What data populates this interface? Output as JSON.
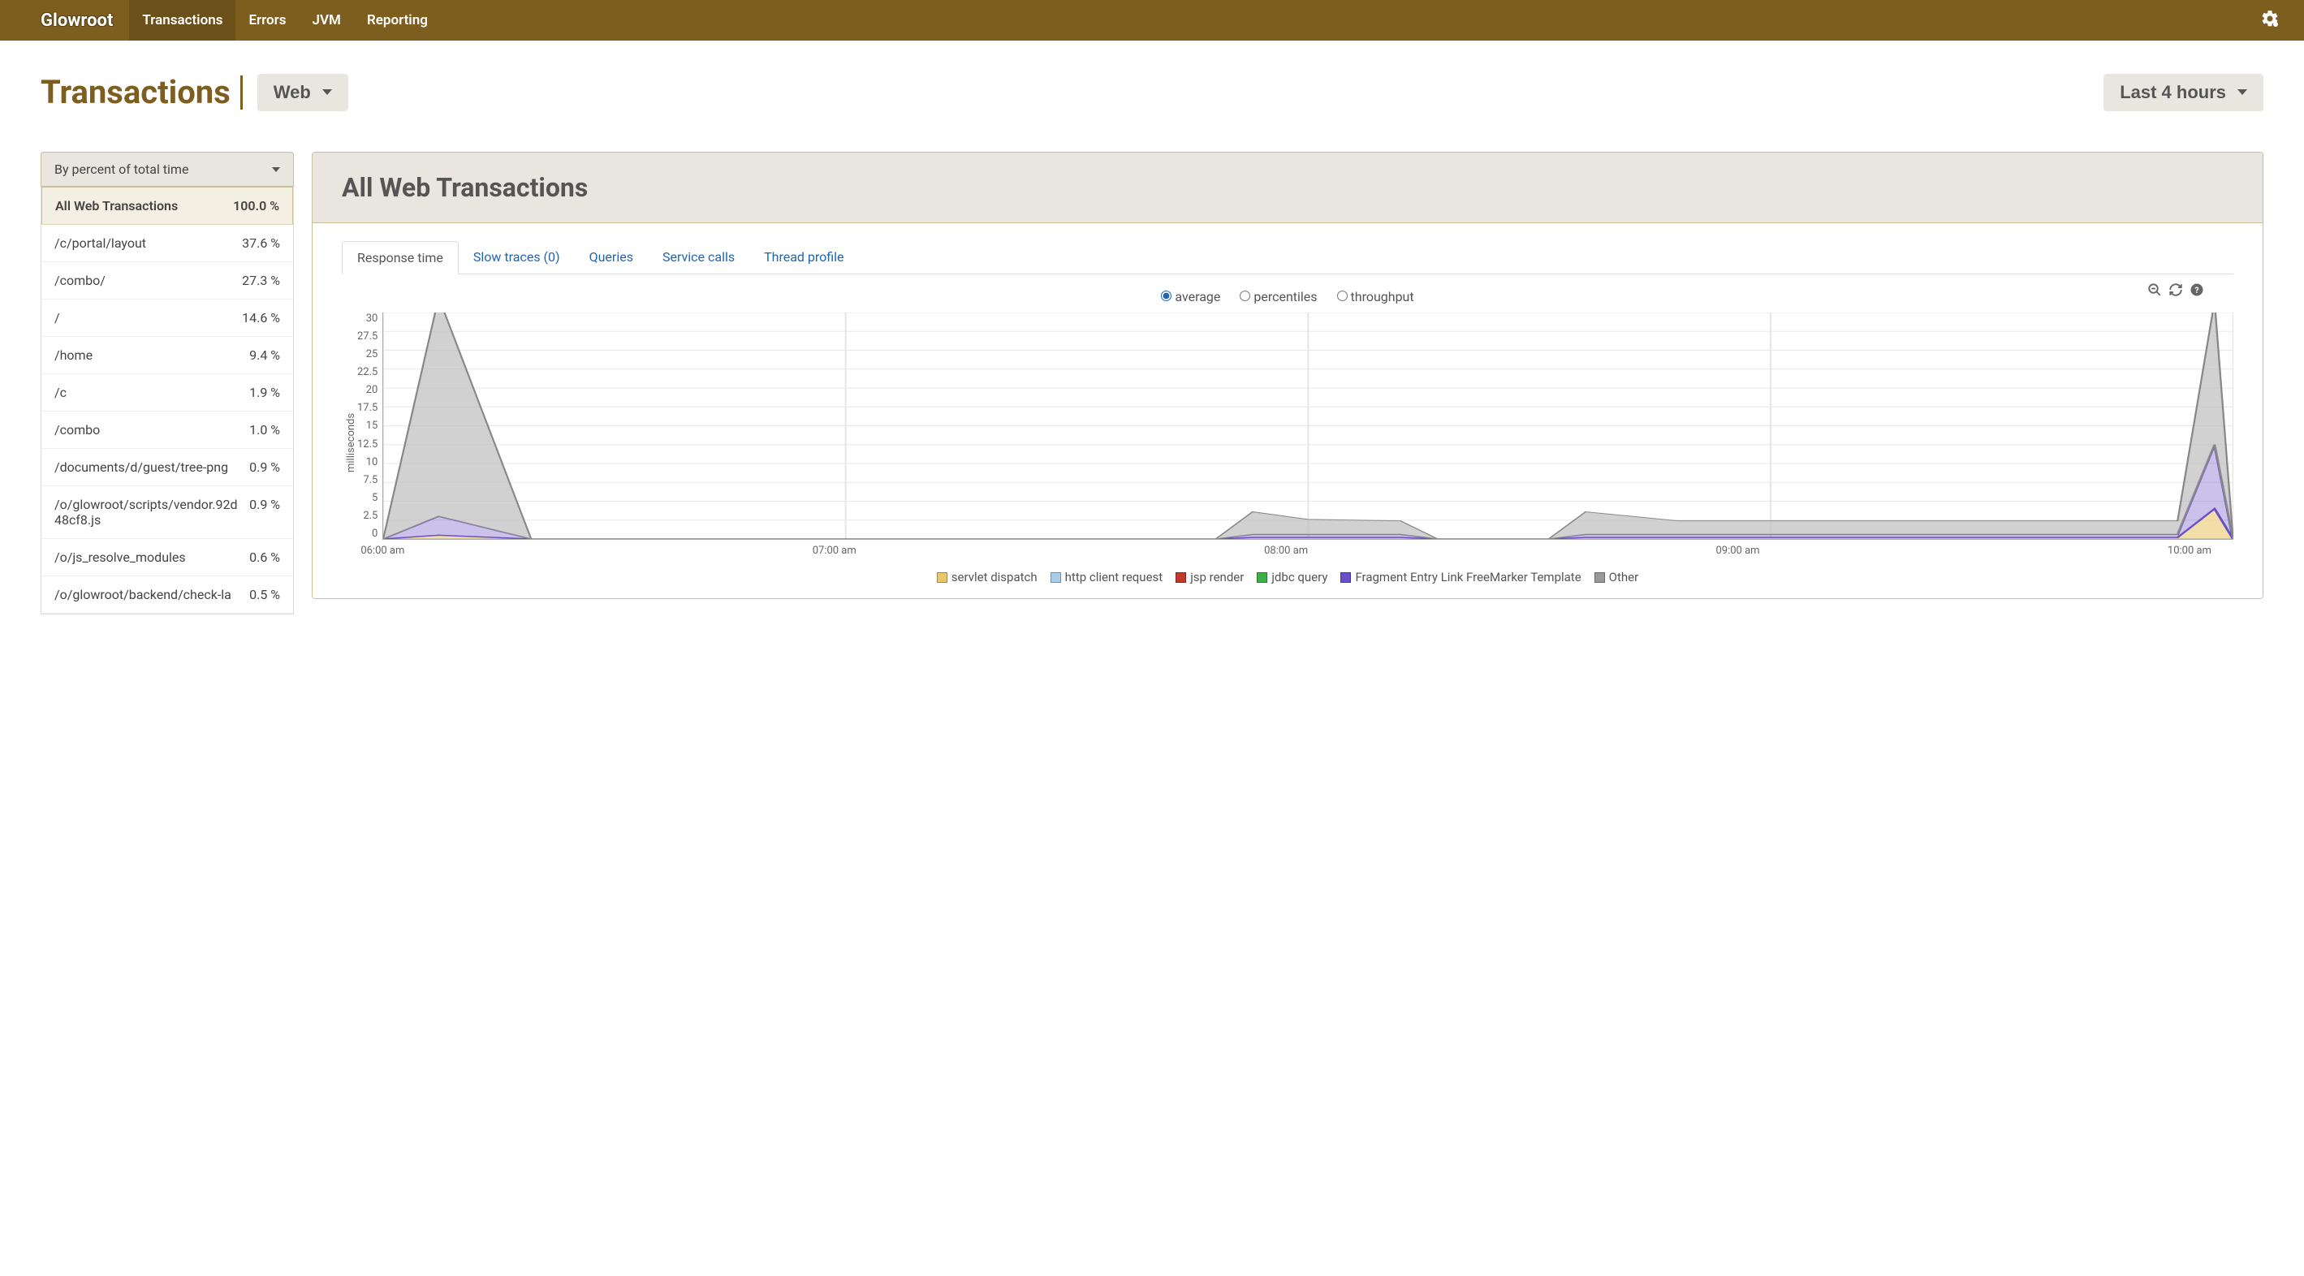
{
  "brand": "Glowroot",
  "nav": {
    "items": [
      {
        "label": "Transactions",
        "active": true
      },
      {
        "label": "Errors",
        "active": false
      },
      {
        "label": "JVM",
        "active": false
      },
      {
        "label": "Reporting",
        "active": false
      }
    ]
  },
  "page_title": "Transactions",
  "type_dropdown": "Web",
  "time_range": "Last 4 hours",
  "sort_by": "By percent of total time",
  "transactions": [
    {
      "name": "All Web Transactions",
      "pct": "100.0 %",
      "selected": true
    },
    {
      "name": "/c/portal/layout",
      "pct": "37.6 %"
    },
    {
      "name": "/combo/",
      "pct": "27.3 %"
    },
    {
      "name": "/",
      "pct": "14.6 %"
    },
    {
      "name": "/home",
      "pct": "9.4 %"
    },
    {
      "name": "/c",
      "pct": "1.9 %"
    },
    {
      "name": "/combo",
      "pct": "1.0 %"
    },
    {
      "name": "/documents/d/guest/tree-png",
      "pct": "0.9 %"
    },
    {
      "name": "/o/glowroot/scripts/vendor.92d48cf8.js",
      "pct": "0.9 %"
    },
    {
      "name": "/o/js_resolve_modules",
      "pct": "0.6 %"
    },
    {
      "name": "/o/glowroot/backend/check-la",
      "pct": "0.5 %"
    }
  ],
  "main_title": "All Web Transactions",
  "tabs": [
    {
      "label": "Response time",
      "active": true
    },
    {
      "label": "Slow traces (0)"
    },
    {
      "label": "Queries"
    },
    {
      "label": "Service calls"
    },
    {
      "label": "Thread profile"
    }
  ],
  "radios": {
    "average": "average",
    "percentiles": "percentiles",
    "throughput": "throughput"
  },
  "chart_data": {
    "type": "area",
    "title": "",
    "xlabel": "",
    "ylabel": "milliseconds",
    "ylim": [
      0,
      30
    ],
    "yticks": [
      30,
      27.5,
      25,
      22.5,
      20,
      17.5,
      15,
      12.5,
      10,
      7.5,
      5,
      2.5,
      0
    ],
    "xticks": [
      "06:00 am",
      "07:00 am",
      "08:00 am",
      "09:00 am",
      "10:00 am"
    ],
    "series": [
      {
        "name": "servlet dispatch",
        "color": "#e9c86b"
      },
      {
        "name": "http client request",
        "color": "#a9cce8"
      },
      {
        "name": "jsp render",
        "color": "#c0392b"
      },
      {
        "name": "jdbc query",
        "color": "#3fae49"
      },
      {
        "name": "Fragment Entry Link FreeMarker Template",
        "color": "#6b4fc9"
      },
      {
        "name": "Other",
        "color": "#999999"
      }
    ],
    "stacked_points": [
      {
        "x": 0.0,
        "fragment": 0,
        "other": 0,
        "servlet": 0
      },
      {
        "x": 0.03,
        "fragment": 2.5,
        "other": 29,
        "servlet": 0.5
      },
      {
        "x": 0.08,
        "fragment": 0,
        "other": 0,
        "servlet": 0
      },
      {
        "x": 0.45,
        "fragment": 0,
        "other": 0,
        "servlet": 0
      },
      {
        "x": 0.47,
        "fragment": 0.4,
        "other": 3.0,
        "servlet": 0.2
      },
      {
        "x": 0.5,
        "fragment": 0.4,
        "other": 2.0,
        "servlet": 0.2
      },
      {
        "x": 0.55,
        "fragment": 0.4,
        "other": 1.8,
        "servlet": 0.2
      },
      {
        "x": 0.57,
        "fragment": 0,
        "other": 0,
        "servlet": 0
      },
      {
        "x": 0.63,
        "fragment": 0,
        "other": 0,
        "servlet": 0
      },
      {
        "x": 0.65,
        "fragment": 0.4,
        "other": 3.0,
        "servlet": 0.2
      },
      {
        "x": 0.7,
        "fragment": 0.4,
        "other": 1.8,
        "servlet": 0.2
      },
      {
        "x": 0.9,
        "fragment": 0.4,
        "other": 1.8,
        "servlet": 0.2
      },
      {
        "x": 0.97,
        "fragment": 0.4,
        "other": 1.8,
        "servlet": 0.2
      },
      {
        "x": 0.99,
        "fragment": 8.5,
        "other": 19,
        "servlet": 4
      },
      {
        "x": 1.0,
        "fragment": 0,
        "other": 0,
        "servlet": 0
      }
    ]
  }
}
